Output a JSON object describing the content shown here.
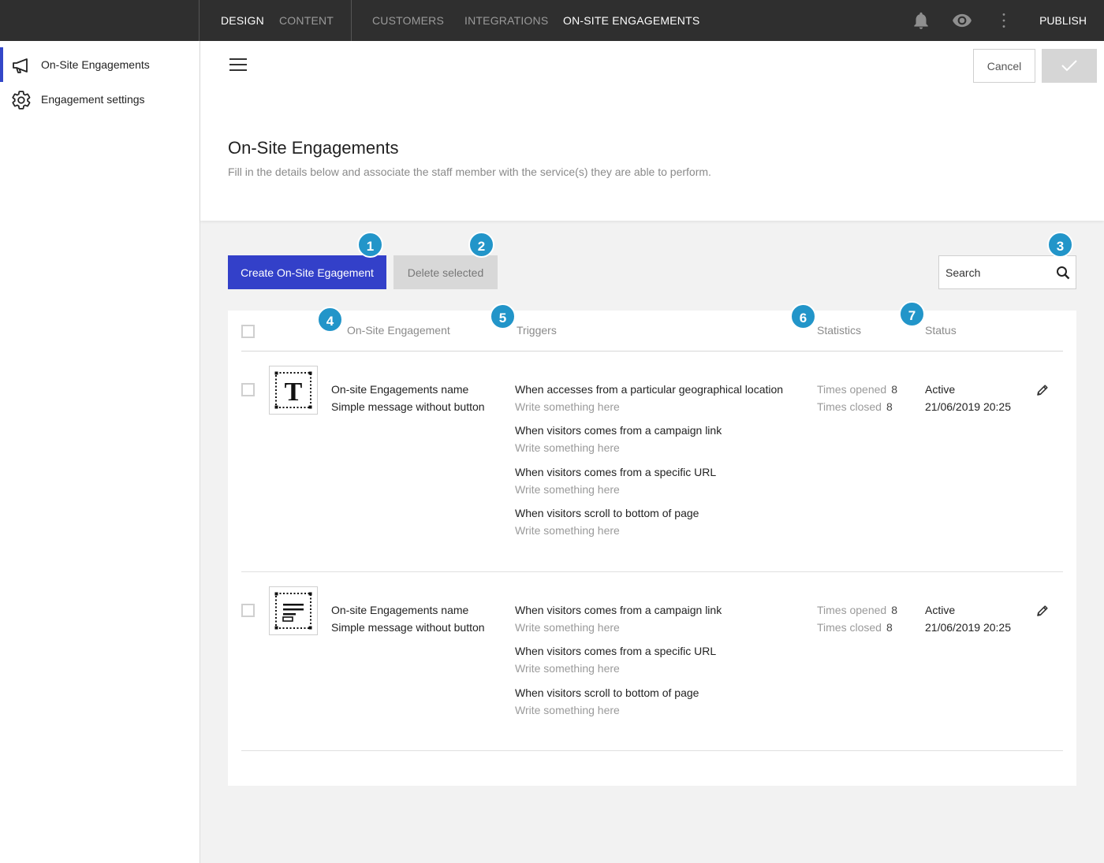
{
  "topnav": {
    "items": [
      "DESIGN",
      "CONTENT",
      "CUSTOMERS",
      "INTEGRATIONS",
      "ON-SITE ENGAGEMENTS"
    ],
    "active": "ON-SITE ENGAGEMENTS",
    "publish_label": "PUBLISH",
    "icons": [
      "bell-icon",
      "eye-icon",
      "more-vertical-icon"
    ]
  },
  "sidebar": {
    "items": [
      {
        "label": "On-Site Engagements",
        "icon": "megaphone-icon",
        "active": true
      },
      {
        "label": "Engagement settings",
        "icon": "gear-icon",
        "active": false
      }
    ]
  },
  "header": {
    "cancel_label": "Cancel",
    "title": "On-Site Engagements",
    "description": "Fill in the details below and associate the staff member with the service(s) they are able to perform."
  },
  "actions": {
    "create_label": "Create On-Site Egagement",
    "delete_label": "Delete selected",
    "search_placeholder": "Search"
  },
  "badges": [
    "1",
    "2",
    "3",
    "4",
    "5",
    "6",
    "7"
  ],
  "table": {
    "columns": [
      "On-Site Engagement",
      "Triggers",
      "Statistics",
      "Status"
    ],
    "rows": [
      {
        "thumb": "text-block-icon",
        "name": "On-site Engagements name",
        "subtitle": "Simple message without button",
        "triggers": [
          {
            "title": "When accesses from a particular geographical location",
            "note": "Write something here"
          },
          {
            "title": "When visitors comes from a campaign link",
            "note": "Write something here"
          },
          {
            "title": "When visitors comes from a specific URL",
            "note": "Write something here"
          },
          {
            "title": "When visitors scroll to bottom of page",
            "note": "Write something here"
          }
        ],
        "stats": {
          "opened_label": "Times opened",
          "opened": "8",
          "closed_label": "Times closed",
          "closed": "8"
        },
        "status": "Active",
        "date": "21/06/2019 20:25"
      },
      {
        "thumb": "text-lines-icon",
        "name": "On-site Engagements name",
        "subtitle": "Simple message without button",
        "triggers": [
          {
            "title": "When visitors comes from a campaign link",
            "note": "Write something here"
          },
          {
            "title": "When visitors comes from a specific URL",
            "note": "Write something here"
          },
          {
            "title": "When visitors scroll to bottom of page",
            "note": "Write something here"
          }
        ],
        "stats": {
          "opened_label": "Times opened",
          "opened": "8",
          "closed_label": "Times closed",
          "closed": "8"
        },
        "status": "Active",
        "date": "21/06/2019 20:25"
      }
    ]
  },
  "colors": {
    "primary": "#3340c9",
    "badge": "#2295c9",
    "topbar": "#2f2f2f"
  }
}
